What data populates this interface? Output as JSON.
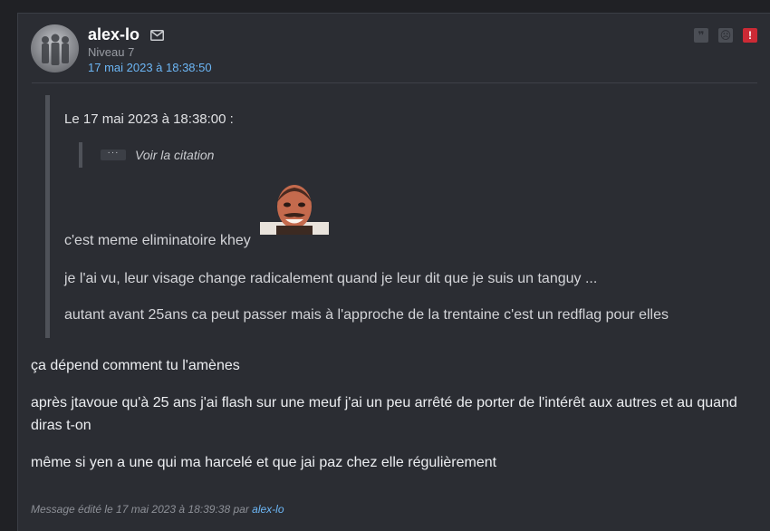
{
  "author": {
    "username": "alex-lo",
    "level": "Niveau 7",
    "post_date": "17 mai 2023 à 18:38:50",
    "avatar_icon": "avatar-silhouettes",
    "mail_icon": "envelope-icon"
  },
  "actions": [
    {
      "name": "quote-button",
      "icon": "quote-icon",
      "glyph": "❞"
    },
    {
      "name": "ignore-button",
      "icon": "sad-face-icon",
      "glyph": "☹"
    },
    {
      "name": "report-button",
      "icon": "alert-icon",
      "glyph": "!"
    }
  ],
  "quote": {
    "header": "Le 17 mai 2023 à 18:38:00 :",
    "nested_toggle": "Voir la citation",
    "lines": [
      "c'est meme eliminatoire khey",
      "je l'ai vu, leur visage change radicalement quand je leur dit que je suis un tanguy ...",
      "autant avant 25ans ca peut passer mais à l'approche de la trentaine c'est un redflag pour elles"
    ],
    "sticker_icon": "risitas-sticker"
  },
  "message": {
    "paragraphs": [
      "ça dépend comment tu l'amènes",
      "après jtavoue qu'à 25 ans j'ai flash sur une meuf j'ai un peu arrêté de porter de l'intérêt aux autres et au quand diras t-on",
      "même si yen a une qui ma harcelé et que jai paz chez elle régulièrement"
    ]
  },
  "edit_note": {
    "text": "Message édité le 17 mai 2023 à 18:39:38 par ",
    "editor": "alex-lo"
  },
  "colors": {
    "background": "#2b2d33",
    "link": "#6cb6f5",
    "report": "#cc2a35"
  }
}
